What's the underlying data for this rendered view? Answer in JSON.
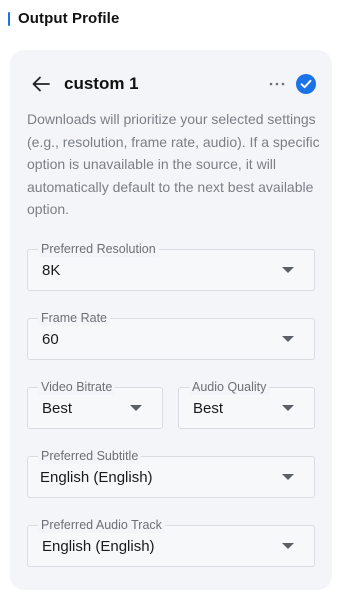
{
  "section": {
    "title": "Output Profile"
  },
  "profile": {
    "name": "custom 1",
    "description": "Downloads will prioritize your selected settings (e.g., resolution, frame rate, audio). If a specific option is unavailable in the source, it will automatically default to the next best available option.",
    "selected": true
  },
  "fields": {
    "resolution": {
      "label": "Preferred Resolution",
      "value": "8K"
    },
    "frame_rate": {
      "label": "Frame Rate",
      "value": "60"
    },
    "video_bitrate": {
      "label": "Video Bitrate",
      "value": "Best"
    },
    "audio_quality": {
      "label": "Audio Quality",
      "value": "Best"
    },
    "subtitle": {
      "label": "Preferred Subtitle",
      "value": "English (English)"
    },
    "audio_track": {
      "label": "Preferred Audio Track",
      "value": "English (English)"
    }
  },
  "colors": {
    "accent": "#1a73e8",
    "card_bg": "#f4f5f8",
    "muted_text": "#7a7f86"
  },
  "icons": {
    "back": "arrow-left-icon",
    "more": "more-horizontal-icon",
    "selected": "check-circle-icon",
    "dropdown": "caret-down-icon"
  }
}
